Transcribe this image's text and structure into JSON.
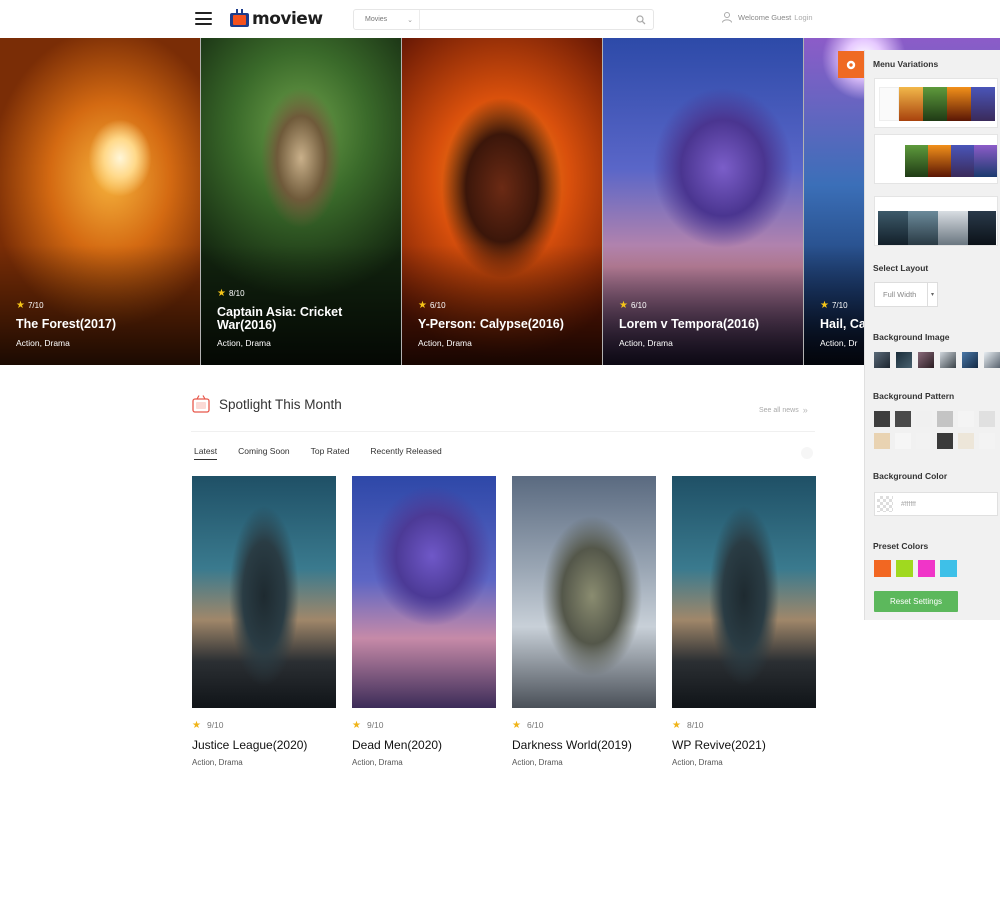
{
  "header": {
    "logo_text": "moview",
    "search_category": "Movies",
    "search_placeholder": "",
    "welcome_text": "Welcome Guest",
    "login_text": "Login"
  },
  "hero": {
    "slides": [
      {
        "rating": "7/10",
        "title": "The Forest(2017)",
        "genre": "Action, Drama"
      },
      {
        "rating": "8/10",
        "title": "Captain Asia: Cricket War(2016)",
        "genre": "Action, Drama"
      },
      {
        "rating": "6/10",
        "title": "Y-Person: Calypse(2016)",
        "genre": "Action, Drama"
      },
      {
        "rating": "6/10",
        "title": "Lorem v Tempora(2016)",
        "genre": "Action, Drama"
      },
      {
        "rating": "7/10",
        "title": "Hail, Ca",
        "genre": "Action, Dr"
      }
    ]
  },
  "panel": {
    "menu_variations": "Menu Variations",
    "select_layout": "Select Layout",
    "layout_value": "Full Width",
    "background_image": "Background Image",
    "background_pattern": "Background Pattern",
    "background_color": "Background Color",
    "color_value": "#ffffff",
    "preset_colors": "Preset Colors",
    "presets": [
      "#f26722",
      "#a0d91f",
      "#f035c8",
      "#3ec0e8"
    ],
    "reset_label": "Reset Settings"
  },
  "spotlight": {
    "title": "Spotlight This Month",
    "see_all": "See all news",
    "tabs": [
      "Latest",
      "Coming Soon",
      "Top Rated",
      "Recently Released"
    ],
    "cards": [
      {
        "rating": "9/10",
        "title": "Justice League(2020)",
        "genre": "Action, Drama"
      },
      {
        "rating": "9/10",
        "title": "Dead Men(2020)",
        "genre": "Action, Drama"
      },
      {
        "rating": "6/10",
        "title": "Darkness World(2019)",
        "genre": "Action, Drama"
      },
      {
        "rating": "8/10",
        "title": "WP Revive(2021)",
        "genre": "Action, Drama"
      }
    ]
  }
}
